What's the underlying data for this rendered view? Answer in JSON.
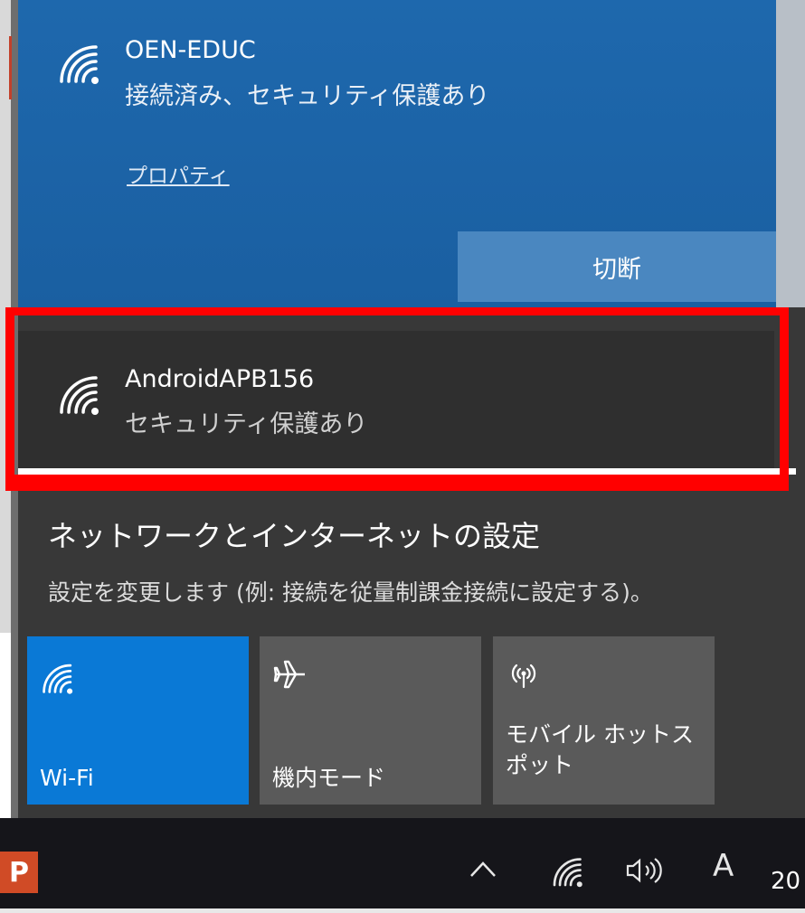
{
  "connected_network": {
    "name": "OEN-EDUC",
    "status": "接続済み、セキュリティ保護あり",
    "properties_link": "プロパティ",
    "disconnect_label": "切断"
  },
  "available_networks": [
    {
      "name": "AndroidAPB156",
      "security": "セキュリティ保護あり"
    }
  ],
  "network_settings": {
    "title": "ネットワークとインターネットの設定",
    "description": "設定を変更します (例: 接続を従量制課金接続に設定する)。"
  },
  "quick_actions": [
    {
      "label": "Wi-Fi",
      "icon": "wifi-icon",
      "active": true
    },
    {
      "label": "機内モード",
      "icon": "airplane-icon",
      "active": false
    },
    {
      "label": "モバイル ホットス\nポット",
      "icon": "hotspot-icon",
      "active": false
    }
  ],
  "taskbar": {
    "input_indicator": "A",
    "clock_fragment": "20",
    "tray_icons": [
      "chevron-up-icon",
      "wifi-icon",
      "speaker-icon"
    ]
  },
  "colors": {
    "connected_bg": "#1e68ad",
    "panel_bg": "#383838",
    "active_tile": "#0a79d6",
    "highlight": "#ff0000"
  }
}
